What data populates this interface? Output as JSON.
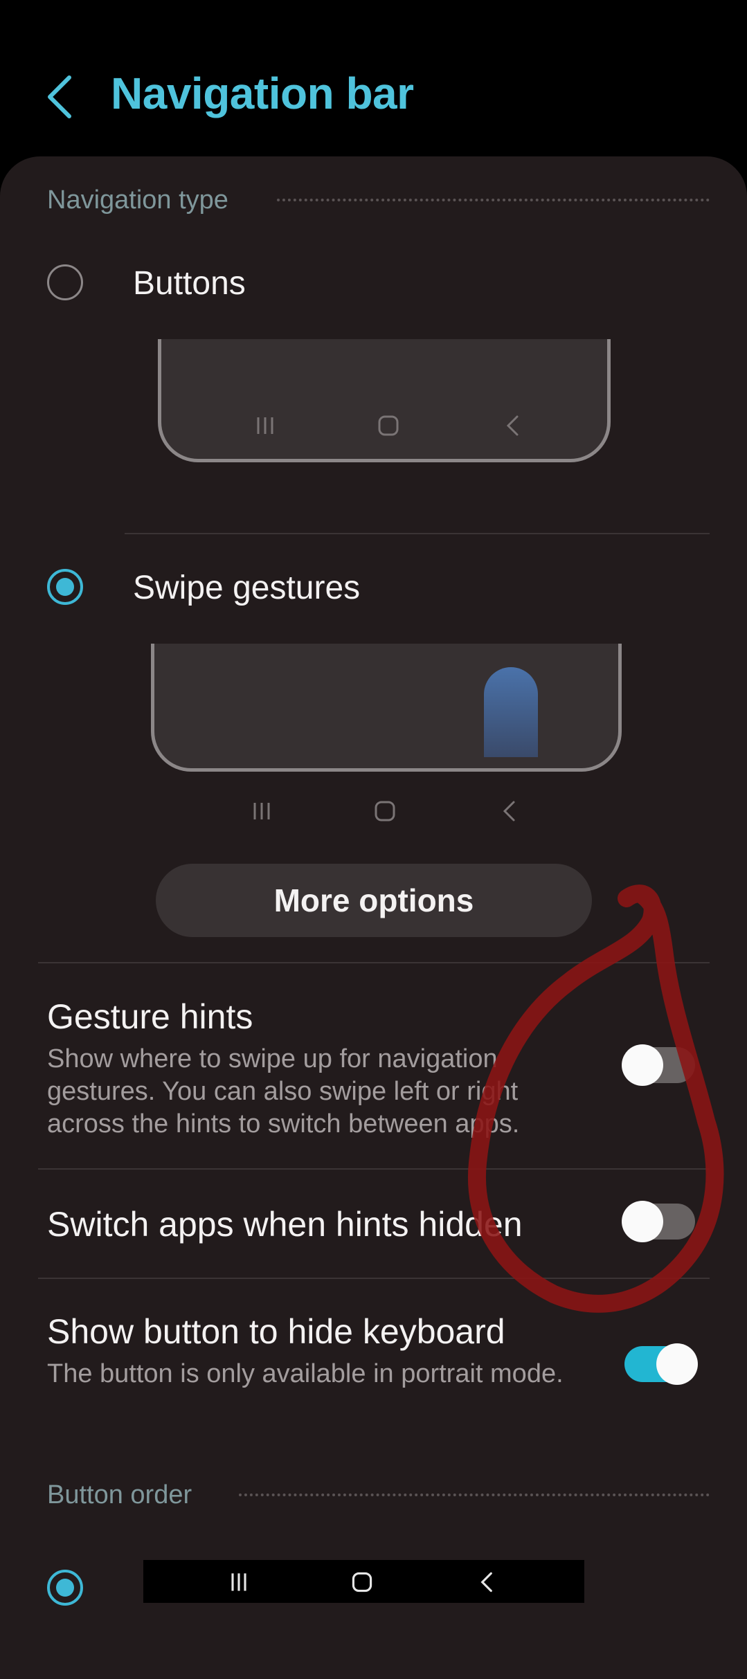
{
  "header": {
    "title": "Navigation bar",
    "back_icon": "chevron-left-icon"
  },
  "navigation_type": {
    "section_label": "Navigation type",
    "options": [
      {
        "label": "Buttons",
        "selected": false
      },
      {
        "label": "Swipe gestures",
        "selected": true
      }
    ],
    "nav_icons": [
      "recents-icon",
      "home-icon",
      "back-icon"
    ]
  },
  "more_options_label": "More options",
  "settings": [
    {
      "title": "Gesture hints",
      "description": "Show where to swipe up for navigation gestures. You can also swipe left or right across the hints to switch between apps.",
      "enabled": false
    },
    {
      "title": "Switch apps when hints hidden",
      "enabled": false
    },
    {
      "title": "Show button to hide keyboard",
      "description": "The button is only available in portrait mode.",
      "enabled": true
    }
  ],
  "button_order": {
    "section_label": "Button order"
  },
  "colors": {
    "accent": "#3eb8d6",
    "title": "#4fc3dc",
    "card": "#221b1c",
    "annotation": "#8b1414"
  }
}
